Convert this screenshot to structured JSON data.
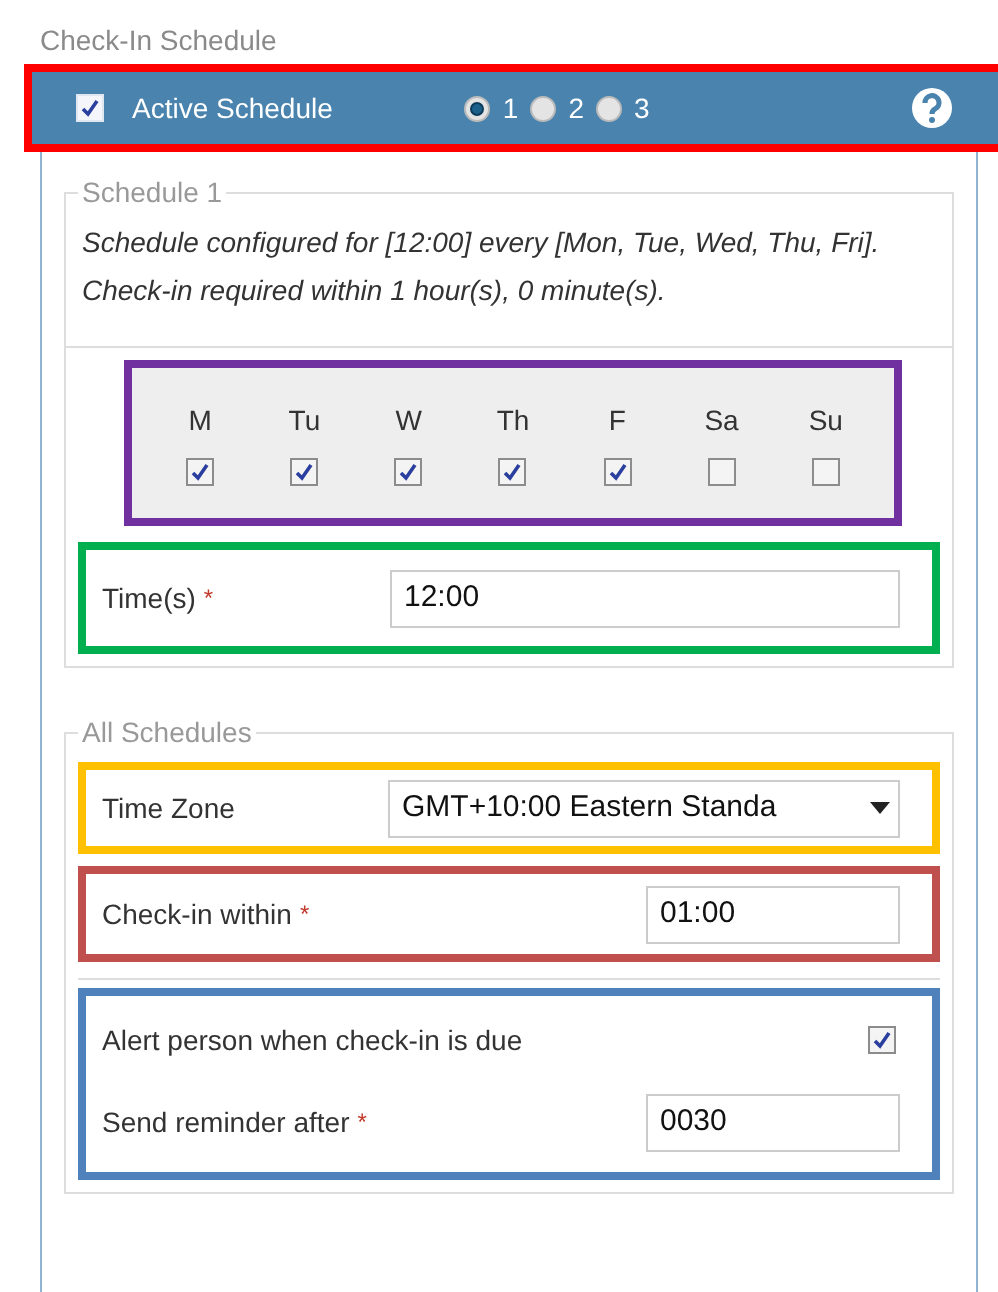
{
  "title": "Check-In Schedule",
  "highlights": [
    {
      "color": "#ff0000"
    },
    {
      "color": "#7030a0"
    },
    {
      "color": "#00b050"
    },
    {
      "color": "#ffc000"
    },
    {
      "color": "#c0504d"
    },
    {
      "color": "#4f81bd"
    }
  ],
  "header": {
    "active": {
      "label": "Active Schedule",
      "checked": true
    },
    "schedules": [
      {
        "label": "1",
        "selected": true
      },
      {
        "label": "2",
        "selected": false
      },
      {
        "label": "3",
        "selected": false
      }
    ]
  },
  "schedule": {
    "legend": "Schedule 1",
    "summary": "Schedule configured for [12:00] every [Mon, Tue, Wed, Thu, Fri]. Check-in required within 1 hour(s), 0 minute(s).",
    "days": [
      {
        "label": "M",
        "checked": true
      },
      {
        "label": "Tu",
        "checked": true
      },
      {
        "label": "W",
        "checked": true
      },
      {
        "label": "Th",
        "checked": true
      },
      {
        "label": "F",
        "checked": true
      },
      {
        "label": "Sa",
        "checked": false
      },
      {
        "label": "Su",
        "checked": false
      }
    ],
    "times": {
      "label": "Time(s)",
      "required_mark": "*",
      "value": "12:00"
    }
  },
  "all_schedules": {
    "legend": "All Schedules",
    "time_zone": {
      "label": "Time Zone",
      "value": "GMT+10:00 Eastern Standa"
    },
    "check_in_within": {
      "label": "Check-in within",
      "required_mark": "*",
      "value": "01:00"
    },
    "alert": {
      "label": "Alert person when check-in is due",
      "checked": true
    },
    "reminder": {
      "label": "Send reminder after",
      "required_mark": "*",
      "value": "0030"
    }
  }
}
